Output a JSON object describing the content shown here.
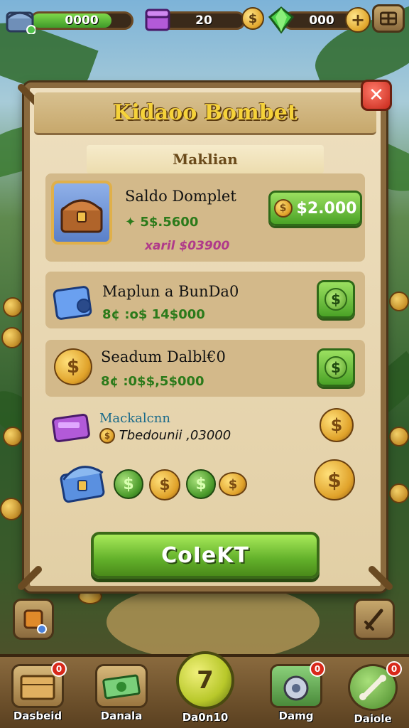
{
  "hud": {
    "chest_value": "0000",
    "purple_value": "20",
    "gem_value": "000"
  },
  "panel": {
    "title": "Kidaoo Bombet",
    "subtitle": "Maklian",
    "close_icon": "close-icon"
  },
  "offers": [
    {
      "title": "Saldo Domplet",
      "price_line1": "5$.5600",
      "price_line2": "xaril $03900",
      "button": "$2.000",
      "icon": "treasure-chest-icon"
    },
    {
      "title": "Maplun a BunDa0",
      "price_line1": "8¢ :o$ 14$000",
      "icon": "blue-lockbox-icon"
    },
    {
      "title": "Seadum Dalbl€0",
      "price_line1": "8¢ :0$$,5$000",
      "icon": "gold-coin-icon"
    }
  ],
  "extra": {
    "title": "Mackalcnn",
    "detail": "Tbedounii ,03000"
  },
  "collect_label": "CoIeKT",
  "nav": [
    {
      "label": "Dasbeid",
      "badge": "0",
      "icon": "crate-icon"
    },
    {
      "label": "Danala",
      "icon": "cash-icon"
    },
    {
      "label": "Da0n10",
      "icon": "coin-center-icon"
    },
    {
      "label": "Damg",
      "badge": "0",
      "icon": "bag-icon"
    },
    {
      "label": "Daiole",
      "badge": "0",
      "icon": "bone-icon"
    }
  ]
}
